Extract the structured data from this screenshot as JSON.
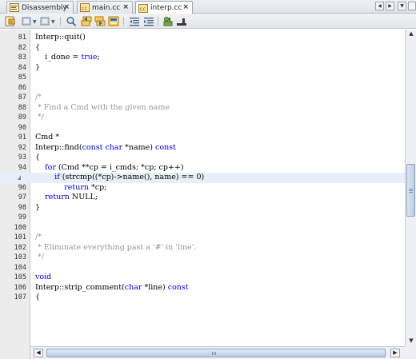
{
  "tabs": [
    {
      "label": "Disassembly",
      "active": false
    },
    {
      "label": "main.cc",
      "active": false
    },
    {
      "label": "interp.cc",
      "active": true
    }
  ],
  "tab_close_glyph": "×",
  "tab_nav": {
    "left": "◀",
    "right": "▶",
    "list": "▼"
  },
  "toolbar_icons": [
    "last-edit-icon",
    "back-icon",
    "forward-icon",
    "find-icon",
    "find-previous-icon",
    "find-next-icon",
    "toggle-highlight-icon",
    "shift-left-icon",
    "shift-right-icon",
    "macro-record-icon",
    "macro-stop-icon"
  ],
  "colors": {
    "keyword": "#0000e6",
    "comment": "#969696",
    "current_line": "#e9eff8",
    "gutter": "#ececec"
  },
  "code_lines": [
    {
      "num": "81",
      "segments": [
        {
          "t": "Interp::quit()",
          "c": "plain"
        }
      ]
    },
    {
      "num": "82",
      "segments": [
        {
          "t": "{",
          "c": "plain"
        }
      ]
    },
    {
      "num": "83",
      "segments": [
        {
          "t": "    i_done = ",
          "c": "plain"
        },
        {
          "t": "true",
          "c": "kw"
        },
        {
          "t": ";",
          "c": "plain"
        }
      ]
    },
    {
      "num": "84",
      "segments": [
        {
          "t": "}",
          "c": "plain"
        }
      ]
    },
    {
      "num": "85",
      "segments": []
    },
    {
      "num": "86",
      "segments": []
    },
    {
      "num": "87",
      "segments": [
        {
          "t": "/*",
          "c": "cm"
        }
      ]
    },
    {
      "num": "88",
      "segments": [
        {
          "t": " * Find a Cmd with the given name",
          "c": "cm"
        }
      ]
    },
    {
      "num": "89",
      "segments": [
        {
          "t": " */",
          "c": "cm"
        }
      ]
    },
    {
      "num": "90",
      "segments": []
    },
    {
      "num": "91",
      "segments": [
        {
          "t": "Cmd *",
          "c": "plain"
        }
      ]
    },
    {
      "num": "92",
      "segments": [
        {
          "t": "Interp::find(",
          "c": "plain"
        },
        {
          "t": "const",
          "c": "kw"
        },
        {
          "t": " ",
          "c": "plain"
        },
        {
          "t": "char",
          "c": "kw"
        },
        {
          "t": " *name) ",
          "c": "plain"
        },
        {
          "t": "const",
          "c": "kw"
        }
      ]
    },
    {
      "num": "93",
      "segments": [
        {
          "t": "{",
          "c": "plain"
        }
      ]
    },
    {
      "num": "94",
      "segments": [
        {
          "t": "    ",
          "c": "plain"
        },
        {
          "t": "for",
          "c": "kw"
        },
        {
          "t": " (Cmd **cp = i_cmds; *cp; cp++)",
          "c": "plain"
        }
      ]
    },
    {
      "num": "",
      "marker": true,
      "highlight": true,
      "segments": [
        {
          "t": "        ",
          "c": "plain"
        },
        {
          "t": "if",
          "c": "kw"
        },
        {
          "t": " (strcmp((*cp)->name(), name) == 0)",
          "c": "plain"
        }
      ]
    },
    {
      "num": "96",
      "segments": [
        {
          "t": "            ",
          "c": "plain"
        },
        {
          "t": "return",
          "c": "kw"
        },
        {
          "t": " *cp;",
          "c": "plain"
        }
      ]
    },
    {
      "num": "97",
      "segments": [
        {
          "t": "    ",
          "c": "plain"
        },
        {
          "t": "return",
          "c": "kw"
        },
        {
          "t": " NULL;",
          "c": "plain"
        }
      ]
    },
    {
      "num": "98",
      "segments": [
        {
          "t": "}",
          "c": "plain"
        }
      ]
    },
    {
      "num": "99",
      "segments": []
    },
    {
      "num": "100",
      "segments": []
    },
    {
      "num": "101",
      "segments": [
        {
          "t": "/*",
          "c": "cm"
        }
      ]
    },
    {
      "num": "102",
      "segments": [
        {
          "t": " * Eliminate everything past a '#' in 'line'.",
          "c": "cm"
        }
      ]
    },
    {
      "num": "103",
      "segments": [
        {
          "t": " */",
          "c": "cm"
        }
      ]
    },
    {
      "num": "104",
      "segments": []
    },
    {
      "num": "105",
      "segments": [
        {
          "t": "void",
          "c": "kw"
        }
      ]
    },
    {
      "num": "106",
      "segments": [
        {
          "t": "Interp::strip_comment(",
          "c": "plain"
        },
        {
          "t": "char",
          "c": "kw"
        },
        {
          "t": " *line) ",
          "c": "plain"
        },
        {
          "t": "const",
          "c": "kw"
        }
      ]
    },
    {
      "num": "107",
      "segments": [
        {
          "t": "{",
          "c": "plain"
        }
      ]
    }
  ],
  "scroll_glyphs": {
    "up": "▲",
    "down": "▼",
    "left": "◀",
    "right": "▶"
  }
}
